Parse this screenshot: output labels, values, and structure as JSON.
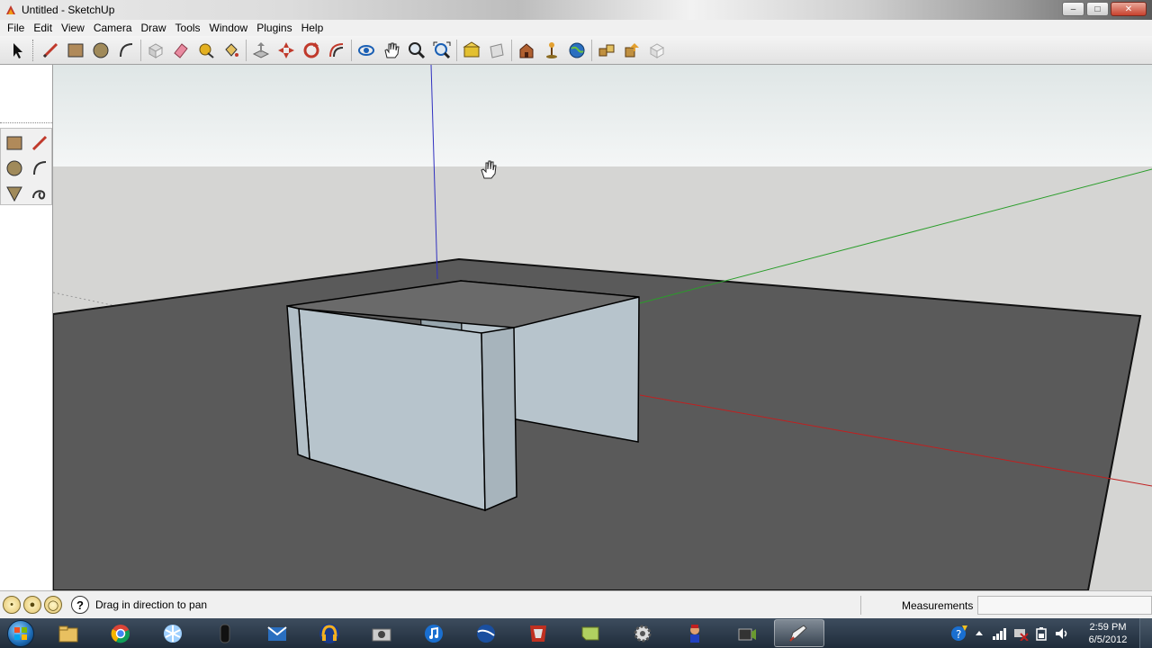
{
  "window": {
    "title": "Untitled - SketchUp"
  },
  "menu": [
    "File",
    "Edit",
    "View",
    "Camera",
    "Draw",
    "Tools",
    "Window",
    "Plugins",
    "Help"
  ],
  "status": {
    "hint": "Drag in direction to pan",
    "measurements_label": "Measurements",
    "measurements_value": ""
  },
  "clock": {
    "time": "2:59 PM",
    "date": "6/5/2012"
  },
  "colors": {
    "ground": "#5a5a5a",
    "sky": "#e8ecec",
    "horizon": "#d7d7d5",
    "wall": "#b7c4cc",
    "blue_axis": "#3030c0",
    "green_axis": "#2a9d2a",
    "red_axis": "#c02020"
  }
}
